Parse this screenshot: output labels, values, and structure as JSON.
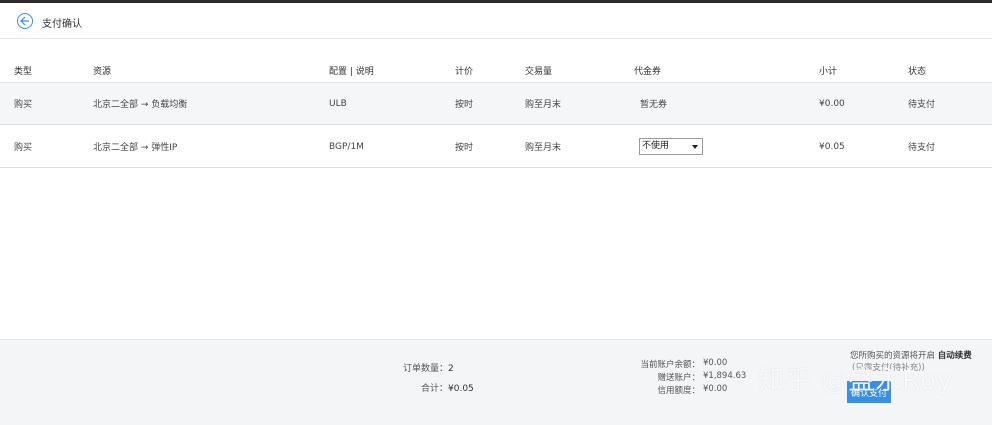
{
  "header": {
    "title": "支付确认",
    "back_icon": "back-arrow-icon"
  },
  "table": {
    "columns": [
      "类型",
      "资源",
      "配置 | 说明",
      "计价",
      "交易量",
      "代金券",
      "小计",
      "状态"
    ],
    "rows": [
      {
        "type": "购买",
        "resource": "北京二全部 → 负载均衡",
        "config": "ULB",
        "pricing": "按时",
        "quantity": "购至月末",
        "voucher": "暂无券",
        "subtotal": "¥0.00",
        "status": "待支付"
      },
      {
        "type": "购买",
        "resource": "北京二全部 → 弹性IP",
        "config": "BGP/1M",
        "pricing": "按时",
        "quantity": "购至月末",
        "voucher": "不使用",
        "subtotal": "¥0.05",
        "status": "待支付"
      }
    ]
  },
  "footer": {
    "order_count_label": "订单数量：",
    "order_count": "2",
    "total_label": "合计：",
    "total": "¥0.05",
    "balance_label": "当前账户余额：",
    "balance": "¥0.00",
    "gift_label": "赠送账户：",
    "gift": "¥1,894.63",
    "credit_label": "信用额度：",
    "credit": "¥0.00",
    "auto_note_prefix": "您所购买的资源将开启",
    "auto_note_bold": "自动续费",
    "auto_note_line2": "(只需支付(待补充))",
    "confirm_label": "确认支付"
  },
  "watermark": "知乎 @盛永Roy",
  "colors": {
    "accent": "#3a8ee6",
    "footer_bg": "#f4f5f7",
    "row_alt_bg": "#f5f6f8"
  }
}
